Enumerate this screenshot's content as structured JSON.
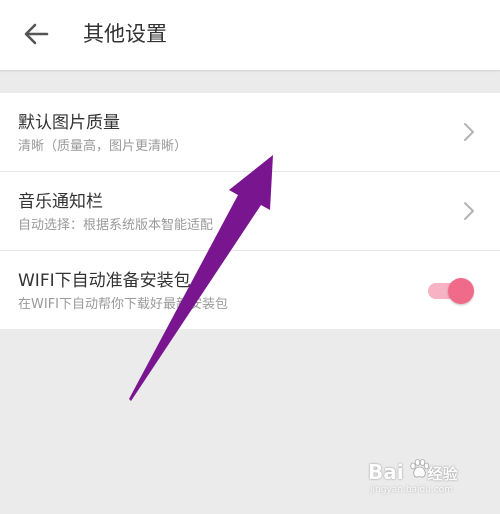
{
  "header": {
    "title": "其他设置",
    "back_icon": "arrow-left-icon"
  },
  "settings": [
    {
      "title": "默认图片质量",
      "subtitle": "清晰（质量高，图片更清晰）",
      "control": "chevron-right-icon"
    },
    {
      "title": "音乐通知栏",
      "subtitle": "自动选择：根据系统版本智能适配",
      "control": "chevron-right-icon"
    },
    {
      "title": "WIFI下自动准备安装包",
      "subtitle": "在WIFI下自动帮你下载好最新安装包",
      "control": "toggle-switch",
      "enabled": true
    }
  ],
  "colors": {
    "background": "#ebebeb",
    "surface": "#ffffff",
    "toggle_thumb": "#f06b8a",
    "toggle_track": "#f7b3c3",
    "annotation_arrow": "#7a1590",
    "primary_text": "#333333",
    "secondary_text": "#9a9a9a"
  },
  "watermark": {
    "brand": "Bai",
    "brand_suffix": "经验",
    "url": "jingyan.baidu.com"
  }
}
